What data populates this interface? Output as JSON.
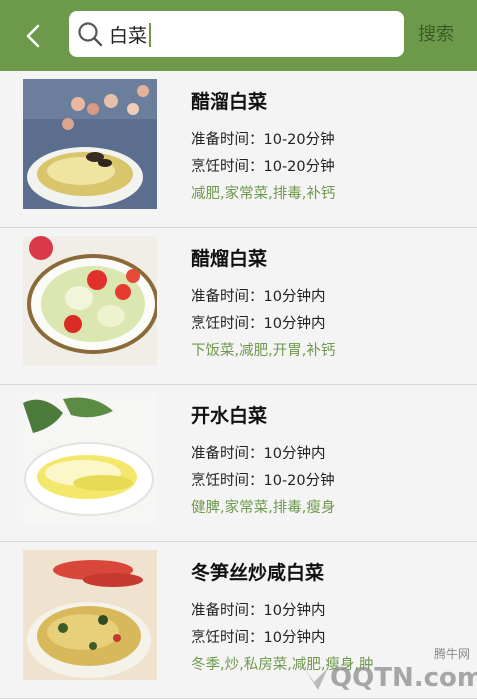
{
  "header": {
    "back_icon": "chevron-left-icon",
    "search": {
      "value": "白菜",
      "icon": "search-icon"
    },
    "search_button_label": "搜索"
  },
  "recipes": [
    {
      "title": "醋溜白菜",
      "prep_label": "准备时间：",
      "prep_time": "10-20分钟",
      "cook_label": "烹饪时间：",
      "cook_time": "10-20分钟",
      "tags": "减肥,家常菜,排毒,补钙"
    },
    {
      "title": "醋熘白菜",
      "prep_label": "准备时间：",
      "prep_time": "10分钟内",
      "cook_label": "烹饪时间：",
      "cook_time": "10分钟内",
      "tags": "下饭菜,减肥,开胃,补钙"
    },
    {
      "title": "开水白菜",
      "prep_label": "准备时间：",
      "prep_time": "10分钟内",
      "cook_label": "烹饪时间：",
      "cook_time": "10-20分钟",
      "tags": "健脾,家常菜,排毒,瘦身"
    },
    {
      "title": "冬笋丝炒咸白菜",
      "prep_label": "准备时间：",
      "prep_time": "10分钟内",
      "cook_label": "烹饪时间：",
      "cook_time": "10分钟内",
      "tags": "冬季,炒,私房菜,减肥,瘦身,肿"
    }
  ],
  "watermark": {
    "site": "腾牛网",
    "logo": "QQTN.com"
  },
  "colors": {
    "header_bg": "#6c9a4a",
    "tag_text": "#6f9a4e"
  }
}
